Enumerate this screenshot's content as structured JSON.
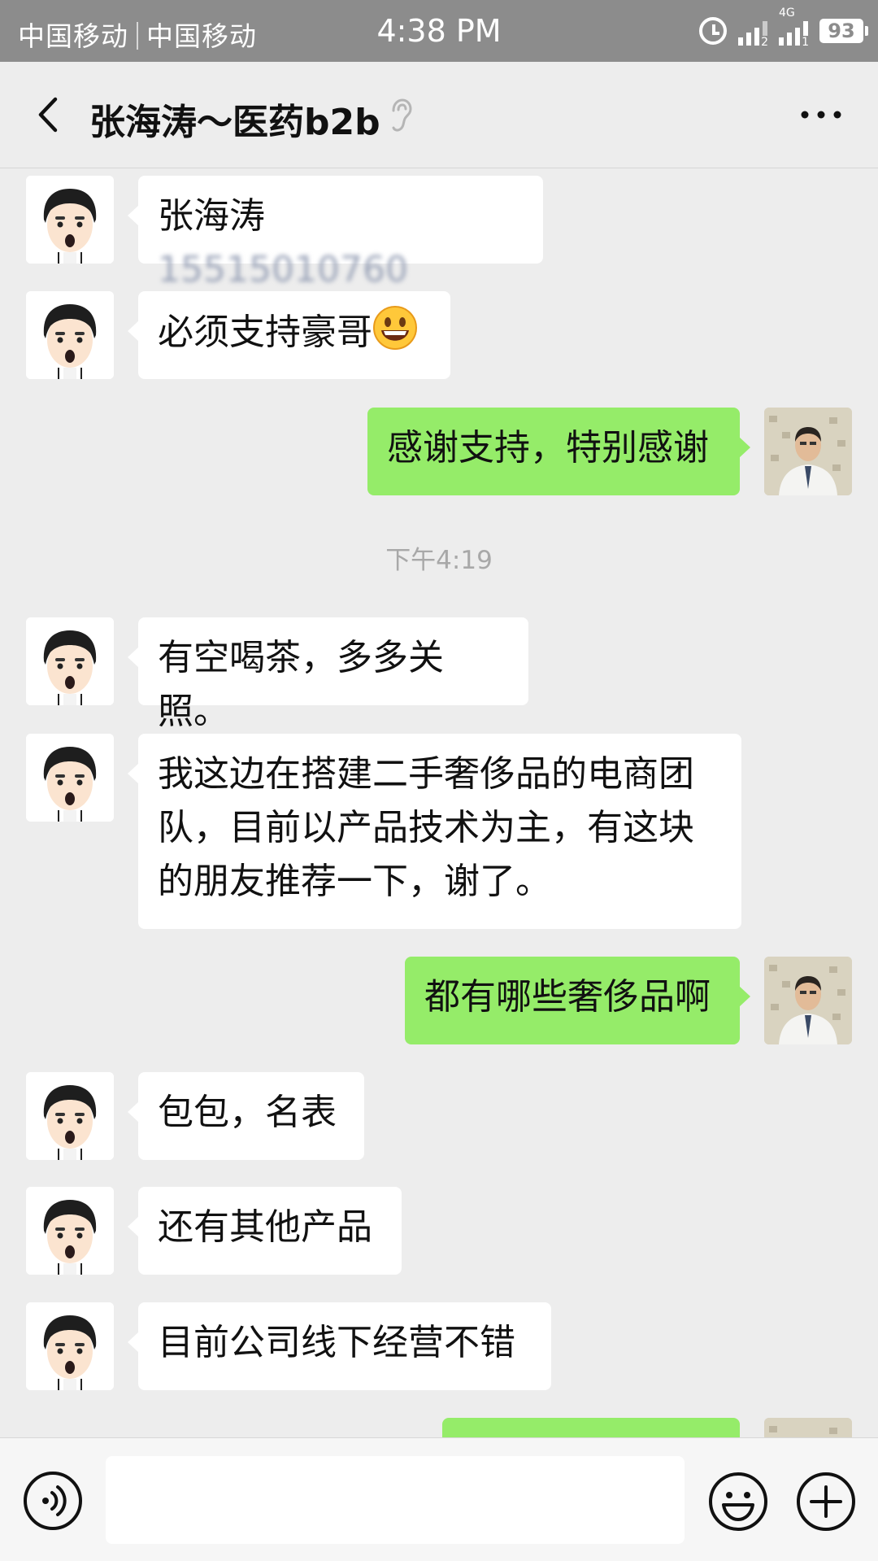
{
  "status_bar": {
    "carrier_1": "中国移动",
    "carrier_2": "中国移动",
    "time": "4:38 PM",
    "sim2_label": "2",
    "network_label": "4G",
    "sim1_label": "1",
    "battery": "93"
  },
  "header": {
    "title": "张海涛～医药b2b",
    "icons": [
      "back-icon",
      "ear-icon",
      "more-icon"
    ]
  },
  "messages": [
    {
      "from": "contact",
      "text": "张海涛",
      "blurred_text": "15515010760"
    },
    {
      "from": "contact",
      "text": "必须支持豪哥",
      "emoji": "grinning-face"
    },
    {
      "from": "me",
      "text": "感谢支持，特别感谢"
    },
    {
      "timestamp": "下午4:19"
    },
    {
      "from": "contact",
      "text": "有空喝茶，多多关照。"
    },
    {
      "from": "contact",
      "text": "我这边在搭建二手奢侈品的电商团\n队，目前以产品技术为主，有这块\n的朋友推荐一下，谢了。"
    },
    {
      "from": "me",
      "text": "都有哪些奢侈品啊"
    },
    {
      "from": "contact",
      "text": "包包，名表"
    },
    {
      "from": "contact",
      "text": "还有其他产品"
    },
    {
      "from": "contact",
      "text": "目前公司线下经营不错"
    },
    {
      "from": "me",
      "text": ""
    }
  ],
  "input_bar": {
    "placeholder": "",
    "icons": [
      "voice-icon",
      "emoji-icon",
      "plus-icon"
    ]
  },
  "colors": {
    "status_bar": "#8c8c8c",
    "background": "#ededed",
    "bubble_me": "#95ec69",
    "bubble_contact": "#ffffff"
  }
}
